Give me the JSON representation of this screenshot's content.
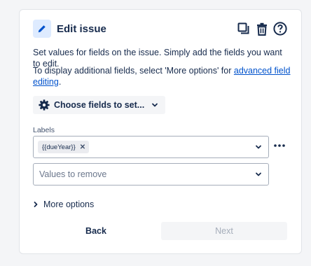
{
  "header": {
    "title": "Edit issue",
    "icons": [
      "edit-pencil-icon",
      "duplicate-icon",
      "trash-icon",
      "help-icon"
    ]
  },
  "description": {
    "line1": "Set values for fields on the issue. Simply add the fields you want to edit.",
    "line2_prefix": "To display additional fields, select 'More options' for ",
    "line2_link": "advanced field editing",
    "line2_suffix": "."
  },
  "choose_fields": {
    "label": "Choose fields to set..."
  },
  "labels_field": {
    "label": "Labels",
    "chips": [
      {
        "text": "{{dueYear}}"
      }
    ],
    "remove_placeholder": "Values to remove"
  },
  "more_options": {
    "label": "More options"
  },
  "footer": {
    "back_label": "Back",
    "next_label": "Next"
  },
  "colors": {
    "accent": "#0052cc",
    "text": "#172b4d",
    "icon_bg": "#deebff",
    "disabled_text": "#a5adba"
  }
}
